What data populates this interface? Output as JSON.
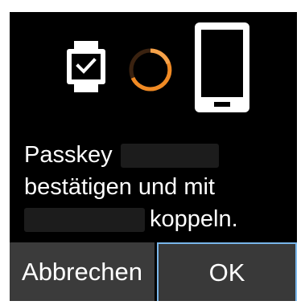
{
  "dialog": {
    "message": {
      "line1_prefix": "Passkey",
      "line2": "bestätigen und mit",
      "line3_suffix": "koppeln."
    },
    "icons": {
      "left": "smartwatch-icon",
      "middle": "loading-spinner-icon",
      "right": "smartphone-icon"
    }
  },
  "buttons": {
    "cancel_label": "Abbrechen",
    "ok_label": "OK"
  },
  "colors": {
    "background": "#000000",
    "spinner_accent": "#f08a24",
    "focus_border": "#79b6ea",
    "button_bg": "#3a3a3a"
  }
}
